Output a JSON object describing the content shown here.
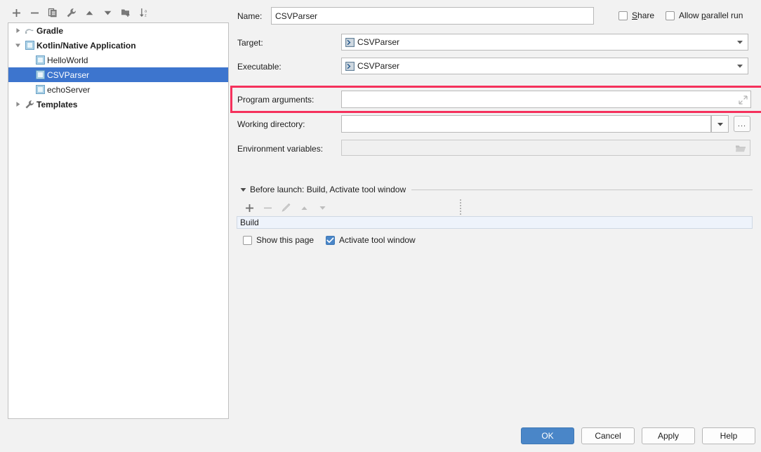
{
  "tree_toolbar": {
    "buttons": [
      {
        "name": "add-configuration-button",
        "icon": "plus-icon",
        "tooltip": "Add New Configuration"
      },
      {
        "name": "remove-configuration-button",
        "icon": "minus-icon",
        "tooltip": "Remove Configuration"
      },
      {
        "name": "copy-configuration-button",
        "icon": "copy-icon",
        "tooltip": "Copy Configuration"
      },
      {
        "name": "edit-templates-button",
        "icon": "wrench-icon",
        "tooltip": "Edit Templates"
      },
      {
        "name": "move-up-button",
        "icon": "arrow-up-icon",
        "tooltip": "Move Up"
      },
      {
        "name": "move-down-button",
        "icon": "arrow-down-icon",
        "tooltip": "Move Down"
      },
      {
        "name": "move-into-folder-button",
        "icon": "folder-add-icon",
        "tooltip": "Move into new folder"
      },
      {
        "name": "sort-configurations-button",
        "icon": "sort-az-icon",
        "tooltip": "Sort Configurations"
      }
    ]
  },
  "tree": {
    "items": [
      {
        "label": "Gradle",
        "level": 0,
        "expander": "collapsed",
        "icon": "gradle-icon",
        "bold": true,
        "selected": false
      },
      {
        "label": "Kotlin/Native Application",
        "level": 0,
        "expander": "expanded",
        "icon": "console-icon",
        "bold": true,
        "selected": false
      },
      {
        "label": "HelloWorld",
        "level": 1,
        "expander": "none",
        "icon": "console-icon",
        "bold": false,
        "selected": false
      },
      {
        "label": "CSVParser",
        "level": 1,
        "expander": "none",
        "icon": "console-icon",
        "bold": false,
        "selected": true
      },
      {
        "label": "echoServer",
        "level": 1,
        "expander": "none",
        "icon": "console-icon",
        "bold": false,
        "selected": false
      },
      {
        "label": "Templates",
        "level": 0,
        "expander": "collapsed",
        "icon": "wrench-icon",
        "bold": true,
        "selected": false
      }
    ]
  },
  "form": {
    "name": {
      "label": "Name:",
      "value": "CSVParser",
      "placeholder": ""
    },
    "share": {
      "label": "Share",
      "mnemonic": "S",
      "checked": false
    },
    "allow_parallel_run": {
      "label": "Allow parallel run",
      "mnemonic": "p",
      "checked": false
    },
    "target": {
      "label": "Target:",
      "value": "CSVParser",
      "icon": "console-icon"
    },
    "executable": {
      "label": "Executable:",
      "value": "CSVParser",
      "icon": "console-icon"
    },
    "program_arguments": {
      "label": "Program arguments:",
      "value": "",
      "placeholder": "",
      "expand_icon": "expand-diagonal-icon",
      "highlighted": true
    },
    "working_directory": {
      "label": "Working directory:",
      "value": "",
      "placeholder": "",
      "dropdown_icon": "chevron-down-icon",
      "browse_label": "..."
    },
    "environment_variables": {
      "label": "Environment variables:",
      "value": "",
      "placeholder": "",
      "disabled": true,
      "browse_icon": "folder-icon"
    }
  },
  "before_launch": {
    "title": "Before launch: Build, Activate tool window",
    "expander": "expanded",
    "toolbar": [
      {
        "name": "add-task-button",
        "icon": "plus-icon",
        "enabled": true
      },
      {
        "name": "remove-task-button",
        "icon": "minus-icon",
        "enabled": false
      },
      {
        "name": "edit-task-button",
        "icon": "pencil-icon",
        "enabled": false
      },
      {
        "name": "task-up-button",
        "icon": "arrow-up-icon",
        "enabled": false
      },
      {
        "name": "task-down-button",
        "icon": "arrow-down-icon",
        "enabled": false
      }
    ],
    "tasks": [
      "Build"
    ],
    "show_this_page": {
      "label": "Show this page",
      "checked": false
    },
    "activate_tool_window": {
      "label": "Activate tool window",
      "checked": true
    }
  },
  "buttons": {
    "ok": "OK",
    "cancel": "Cancel",
    "apply": "Apply",
    "help": "Help"
  },
  "colors": {
    "accent_blue": "#4a86c8",
    "selection_blue": "#3d75ce",
    "highlight_pink": "#f5315c",
    "panel_bg": "#f2f2f2",
    "list_row_bg": "#eef3fb"
  }
}
